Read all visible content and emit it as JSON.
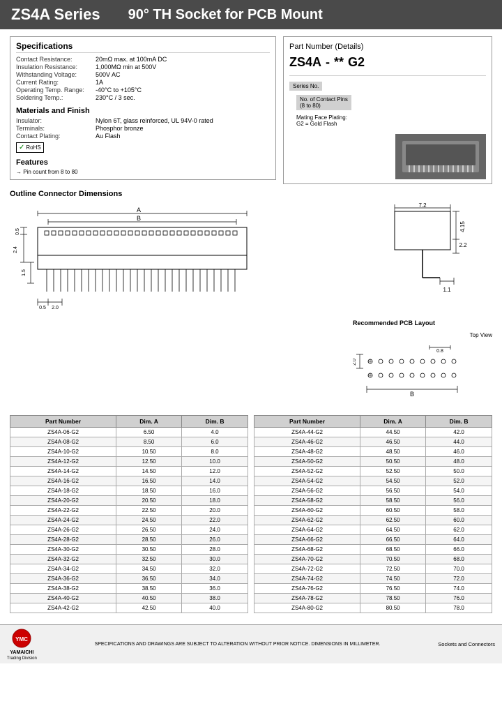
{
  "header": {
    "series": "ZS4A Series",
    "title": "90° TH Socket for PCB Mount"
  },
  "specs": {
    "title": "Specifications",
    "rows": [
      {
        "label": "Contact Resistance:",
        "value": "20mΩ max. at 100mA DC"
      },
      {
        "label": "Insulation Resistance:",
        "value": "1,000MΩ min at 500V"
      },
      {
        "label": "Withstanding Voltage:",
        "value": "500V AC"
      },
      {
        "label": "Current Rating:",
        "value": "1A"
      },
      {
        "label": "Operating Temp. Range:",
        "value": "-40°C to +105°C"
      },
      {
        "label": "Soldering Temp.:",
        "value": "230°C / 3 sec."
      }
    ]
  },
  "materials": {
    "title": "Materials and Finish",
    "rows": [
      {
        "label": "Insulator:",
        "value": "Nylon 6T, glass reinforced, UL 94V-0 rated"
      },
      {
        "label": "Terminals:",
        "value": "Phosphor bronze"
      },
      {
        "label": "Contact Plating:",
        "value": "Au Flash"
      }
    ]
  },
  "features": {
    "title": "Features",
    "items": [
      "→ Pin count from 8 to 80"
    ]
  },
  "partnumber": {
    "title": "Part Number",
    "subtitle": "(Details)",
    "code": "ZS4A",
    "separator": "-",
    "stars": "**",
    "suffix": "G2",
    "labels": [
      {
        "text": "Series No.",
        "arrow": "ZS4A"
      },
      {
        "text": "No. of Contact Pins\n(8 to 80)",
        "arrow": "**"
      },
      {
        "text": "Mating Face Plating:\nG2 = Gold Flash",
        "arrow": "G2"
      }
    ]
  },
  "dimensions": {
    "title": "Outline Connector Dimensions",
    "dim_a_label": "A",
    "dim_b_label": "B",
    "measurements": {
      "top": "0.5",
      "side1": "2.4",
      "side2": "1.5",
      "bottom1": "0.5",
      "bottom2": "2.0",
      "right1": "7.2",
      "right2": "4.15",
      "right3": "2.2",
      "right4": "1.1"
    }
  },
  "pcb_layout": {
    "title": "Recommended PCB Layout",
    "top_view": "Top View",
    "measurements": {
      "dim1": "2.0",
      "dim2": "0.8",
      "dim_b": "B"
    }
  },
  "table_left": {
    "headers": [
      "Part Number",
      "Dim. A",
      "Dim. B"
    ],
    "rows": [
      [
        "ZS4A-06-G2",
        "6.50",
        "4.0"
      ],
      [
        "ZS4A-08-G2",
        "8.50",
        "6.0"
      ],
      [
        "ZS4A-10-G2",
        "10.50",
        "8.0"
      ],
      [
        "ZS4A-12-G2",
        "12.50",
        "10.0"
      ],
      [
        "ZS4A-14-G2",
        "14.50",
        "12.0"
      ],
      [
        "ZS4A-16-G2",
        "16.50",
        "14.0"
      ],
      [
        "ZS4A-18-G2",
        "18.50",
        "16.0"
      ],
      [
        "ZS4A-20-G2",
        "20.50",
        "18.0"
      ],
      [
        "ZS4A-22-G2",
        "22.50",
        "20.0"
      ],
      [
        "ZS4A-24-G2",
        "24.50",
        "22.0"
      ],
      [
        "ZS4A-26-G2",
        "26.50",
        "24.0"
      ],
      [
        "ZS4A-28-G2",
        "28.50",
        "26.0"
      ],
      [
        "ZS4A-30-G2",
        "30.50",
        "28.0"
      ],
      [
        "ZS4A-32-G2",
        "32.50",
        "30.0"
      ],
      [
        "ZS4A-34-G2",
        "34.50",
        "32.0"
      ],
      [
        "ZS4A-36-G2",
        "36.50",
        "34.0"
      ],
      [
        "ZS4A-38-G2",
        "38.50",
        "36.0"
      ],
      [
        "ZS4A-40-G2",
        "40.50",
        "38.0"
      ],
      [
        "ZS4A-42-G2",
        "42.50",
        "40.0"
      ]
    ]
  },
  "table_right": {
    "headers": [
      "Part Number",
      "Dim. A",
      "Dim. B"
    ],
    "rows": [
      [
        "ZS4A-44-G2",
        "44.50",
        "42.0"
      ],
      [
        "ZS4A-46-G2",
        "46.50",
        "44.0"
      ],
      [
        "ZS4A-48-G2",
        "48.50",
        "46.0"
      ],
      [
        "ZS4A-50-G2",
        "50.50",
        "48.0"
      ],
      [
        "ZS4A-52-G2",
        "52.50",
        "50.0"
      ],
      [
        "ZS4A-54-G2",
        "54.50",
        "52.0"
      ],
      [
        "ZS4A-56-G2",
        "56.50",
        "54.0"
      ],
      [
        "ZS4A-58-G2",
        "58.50",
        "56.0"
      ],
      [
        "ZS4A-60-G2",
        "60.50",
        "58.0"
      ],
      [
        "ZS4A-62-G2",
        "62.50",
        "60.0"
      ],
      [
        "ZS4A-64-G2",
        "64.50",
        "62.0"
      ],
      [
        "ZS4A-66-G2",
        "66.50",
        "64.0"
      ],
      [
        "ZS4A-68-G2",
        "68.50",
        "66.0"
      ],
      [
        "ZS4A-70-G2",
        "70.50",
        "68.0"
      ],
      [
        "ZS4A-72-G2",
        "72.50",
        "70.0"
      ],
      [
        "ZS4A-74-G2",
        "74.50",
        "72.0"
      ],
      [
        "ZS4A-76-G2",
        "76.50",
        "74.0"
      ],
      [
        "ZS4A-78-G2",
        "78.50",
        "76.0"
      ],
      [
        "ZS4A-80-G2",
        "80.50",
        "78.0"
      ]
    ]
  },
  "footer": {
    "note": "SPECIFICATIONS AND DRAWINGS ARE SUBJECT TO ALTERATION WITHOUT PRIOR NOTICE. DIMENSIONS IN MILLIMETER.",
    "right": "Sockets and Connectors",
    "company": "YAMAICHI\nTrading Division"
  }
}
